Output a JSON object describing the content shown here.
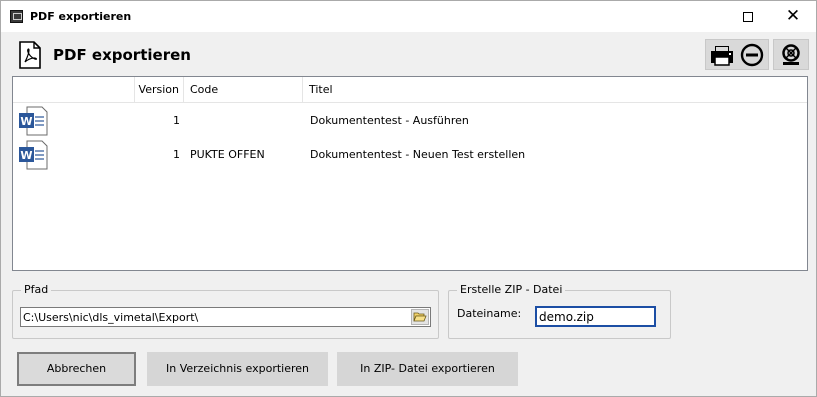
{
  "window": {
    "title": "PDF exportieren",
    "maximize_icon": "maximize-icon",
    "close_glyph": "✕"
  },
  "header": {
    "title": "PDF exportieren",
    "icon": "pdf-document-icon",
    "tools": [
      "printer-icon",
      "remove-circle-icon",
      "lifebuoy-icon"
    ]
  },
  "list": {
    "columns": [
      "",
      "Version",
      "Code",
      "Titel"
    ],
    "rows": [
      {
        "icon": "word-document-icon",
        "version": "1",
        "code": "",
        "titel": "Dokumententest - Ausführen"
      },
      {
        "icon": "word-document-icon",
        "version": "1",
        "code": "PUKTE OFFEN",
        "titel": "Dokumententest - Neuen Test erstellen"
      }
    ]
  },
  "path": {
    "legend": "Pfad",
    "value": "C:\\Users\\nic\\dls_vimetal\\Export\\"
  },
  "zip": {
    "legend": "Erstelle ZIP - Datei",
    "label": "Dateiname:",
    "value": "demo.zip"
  },
  "buttons": {
    "cancel": "Abbrechen",
    "export_dir": "In Verzeichnis exportieren",
    "export_zip": "In ZIP- Datei exportieren"
  },
  "colors": {
    "word_blue": "#2b579a",
    "focus_border": "#1c4ea4",
    "toolbar_bg": "#d9d9d9"
  }
}
